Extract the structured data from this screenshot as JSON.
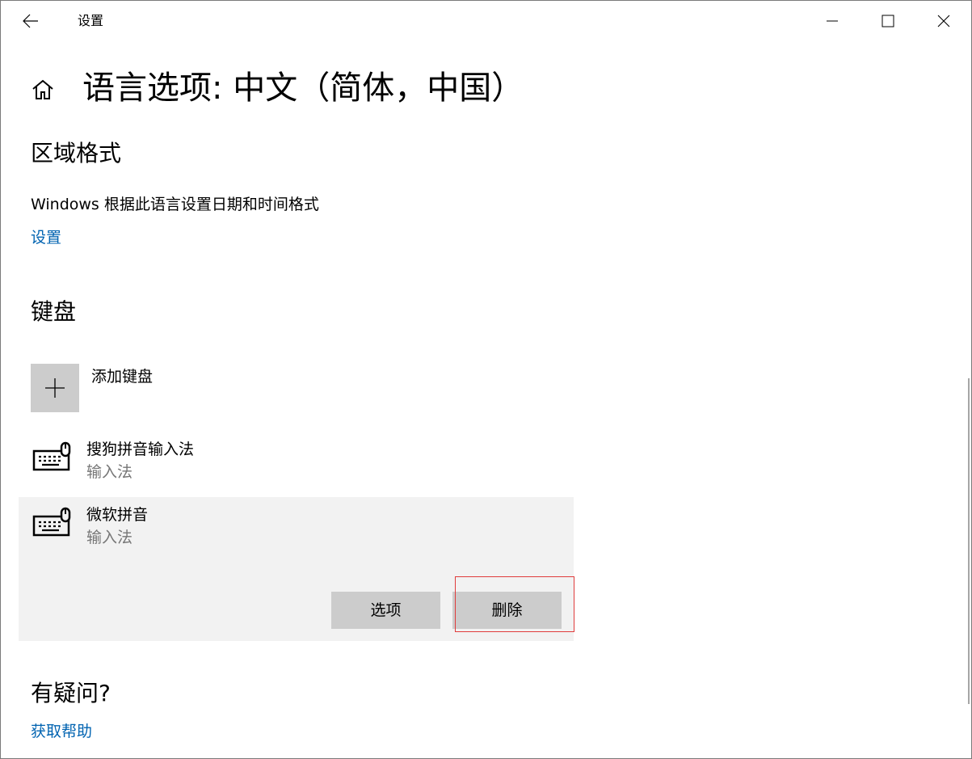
{
  "titlebar": {
    "app_title": "设置",
    "back_icon": "back-arrow-icon",
    "minimize_icon": "minimize-icon",
    "maximize_icon": "maximize-icon",
    "close_icon": "close-icon"
  },
  "page": {
    "home_icon": "home-icon",
    "title": "语言选项: 中文（简体，中国）"
  },
  "region": {
    "heading": "区域格式",
    "description": "Windows 根据此语言设置日期和时间格式",
    "settings_link": "设置"
  },
  "keyboard": {
    "heading": "键盘",
    "add_label": "添加键盘",
    "add_icon": "plus-icon",
    "items": [
      {
        "name": "搜狗拼音输入法",
        "type": "输入法",
        "icon": "keyboard-icon"
      },
      {
        "name": "微软拼音",
        "type": "输入法",
        "icon": "keyboard-icon",
        "selected": true
      }
    ],
    "options_button": "选项",
    "remove_button": "删除"
  },
  "help": {
    "heading": "有疑问?",
    "link": "获取帮助"
  },
  "colors": {
    "accent_link": "#0063b1",
    "button_bg": "#cccccc",
    "selected_row_bg": "#f2f2f2",
    "highlight_border": "#e03c3c"
  }
}
